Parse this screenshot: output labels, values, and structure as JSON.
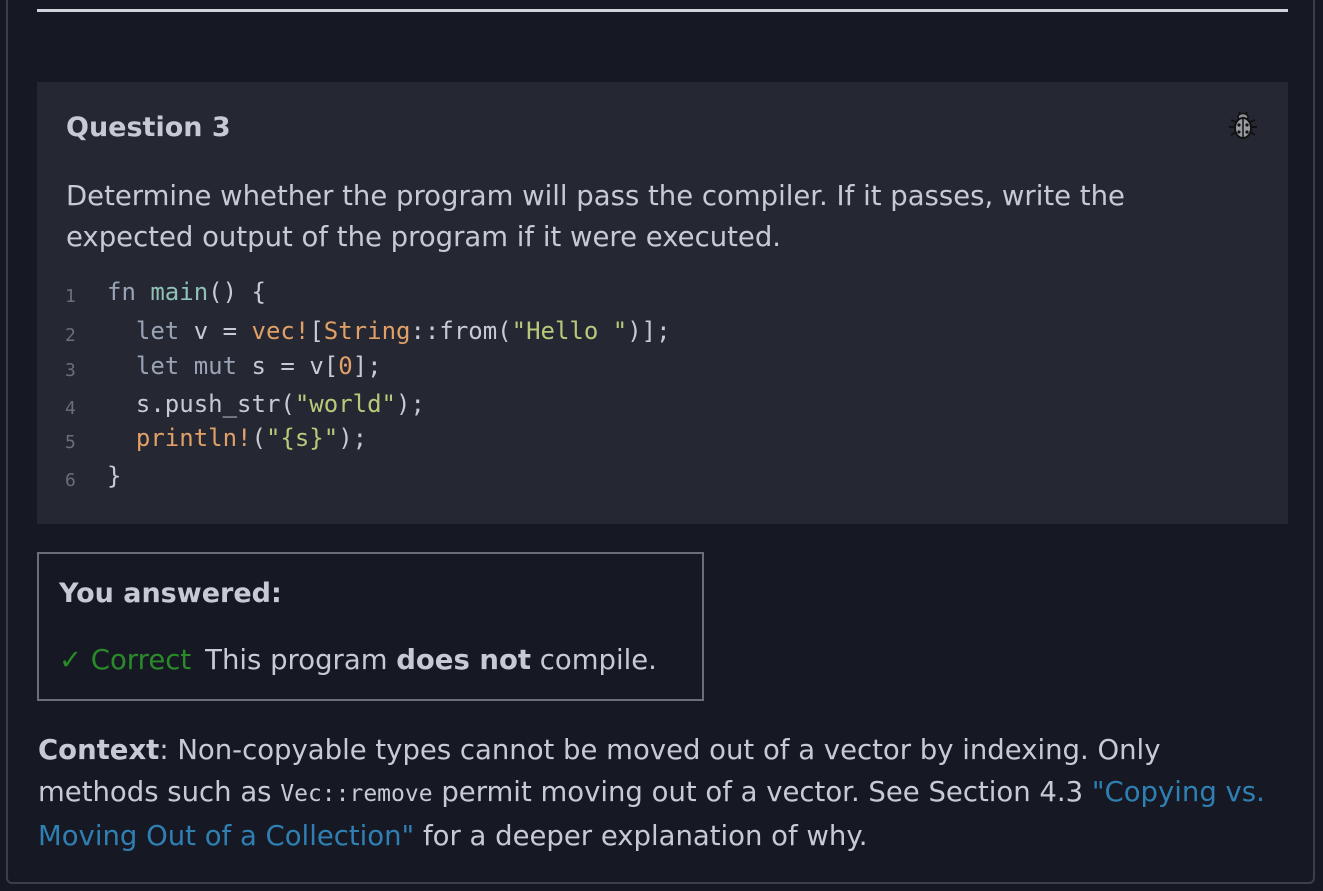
{
  "question": {
    "title": "Question 3",
    "prompt": "Determine whether the program will pass the compiler. If it passes, write the expected output of the program if it were executed.",
    "report_icon": "bug-icon"
  },
  "code": {
    "line_numbers": [
      "1",
      "2",
      "3",
      "4",
      "5",
      "6"
    ]
  },
  "answer": {
    "label": "You answered:",
    "status": "✓ Correct",
    "text_before": "This program ",
    "text_bold": "does not",
    "text_after": " compile."
  },
  "context": {
    "label": "Context",
    "text1": ": Non-copyable types cannot be moved out of a vector by indexing. Only methods such as ",
    "code": "Vec::remove",
    "text2": " permit moving out of a vector. See Section 4.3 ",
    "link": "\"Copying vs. Moving Out of a Collection\"",
    "text3": " for a deeper explanation of why."
  },
  "colors": {
    "background": "#161923",
    "card": "#252833",
    "correct": "#2a8a2a",
    "link": "#2f7fb3"
  }
}
